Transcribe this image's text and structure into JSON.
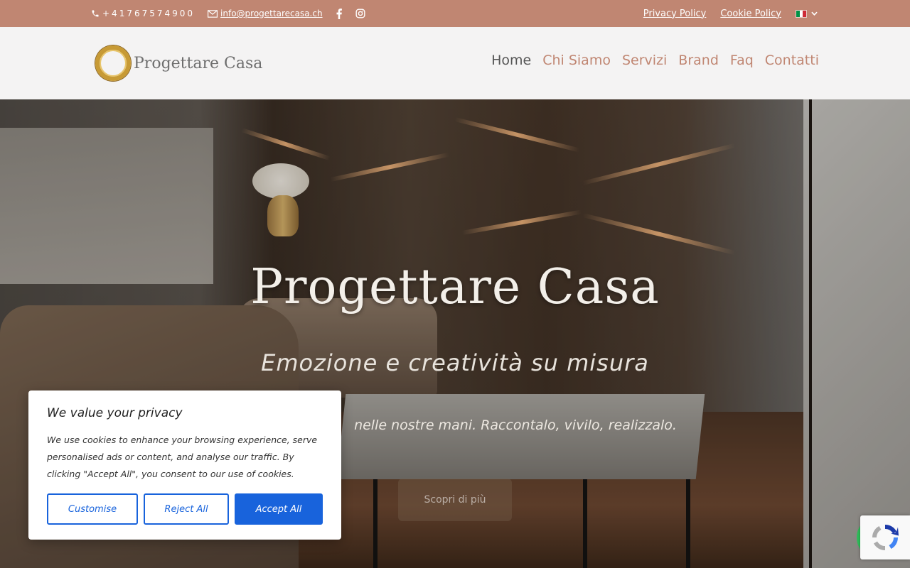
{
  "topbar": {
    "phone": "+41767574900",
    "email": "info@progettarecasa.ch",
    "privacy_policy": "Privacy Policy",
    "cookie_policy": "Cookie Policy"
  },
  "header": {
    "logo_text": "Progettare Casa",
    "nav": [
      {
        "label": "Home"
      },
      {
        "label": "Chi Siamo"
      },
      {
        "label": "Servizi"
      },
      {
        "label": "Brand"
      },
      {
        "label": "Faq"
      },
      {
        "label": "Contatti"
      }
    ]
  },
  "hero": {
    "title": "Progettare Casa",
    "subtitle": "Emozione e creatività su misura",
    "tagline": "nelle nostre mani. Raccontalo, vivilo, realizzalo.",
    "button_label": "Scopri di più"
  },
  "cookie": {
    "title": "We value your privacy",
    "text": "We use cookies to enhance your browsing experience, serve personalised ads or content, and analyse our traffic. By clicking \"Accept All\", you consent to our use of cookies.",
    "customise": "Customise",
    "reject": "Reject All",
    "accept": "Accept All"
  },
  "colors": {
    "brand": "#c08672",
    "accept_blue": "#1863dc"
  },
  "icons": {
    "phone": "phone-icon",
    "email": "envelope-icon",
    "facebook": "facebook-icon",
    "instagram": "instagram-icon",
    "language": "italian-flag-icon",
    "recaptcha": "recaptcha-icon",
    "whatsapp": "whatsapp-icon"
  }
}
